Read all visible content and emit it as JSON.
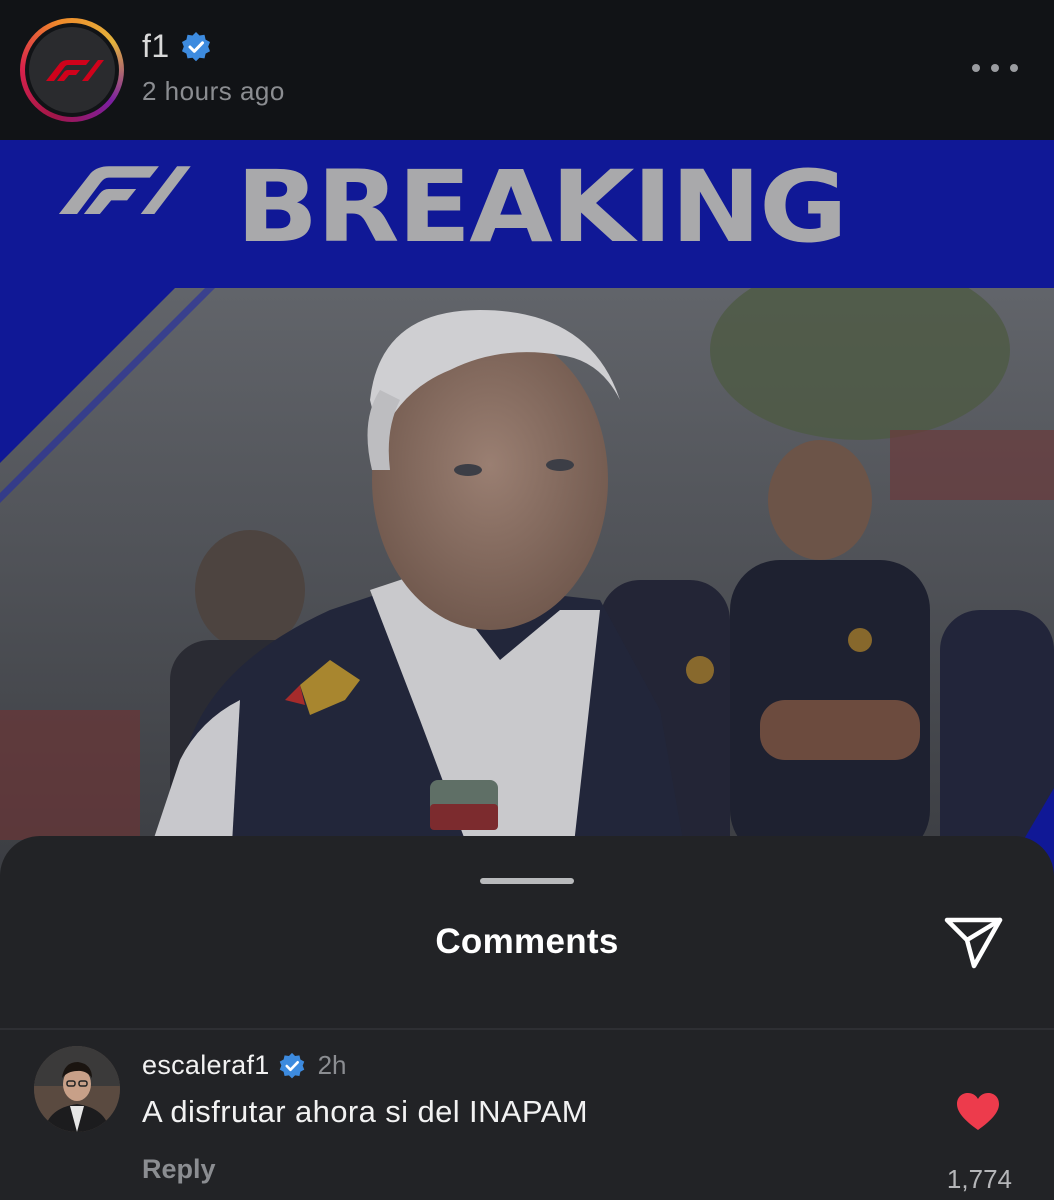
{
  "post": {
    "username": "f1",
    "verified": true,
    "timestamp": "2 hours ago",
    "more_icon": "ellipsis-icon",
    "brand_color": "#d0021b",
    "banner_color": "#101896"
  },
  "image": {
    "banner_text": "BREAKING",
    "logo_icon": "f1-logo-icon"
  },
  "comments_sheet": {
    "title": "Comments",
    "share_icon": "send-icon"
  },
  "comments": [
    {
      "username": "escaleraf1",
      "verified": true,
      "time": "2h",
      "text": "A disfrutar ahora si del INAPAM",
      "reply_label": "Reply",
      "liked": true,
      "like_count": "1,774",
      "like_color": "#ed3b4c"
    }
  ]
}
